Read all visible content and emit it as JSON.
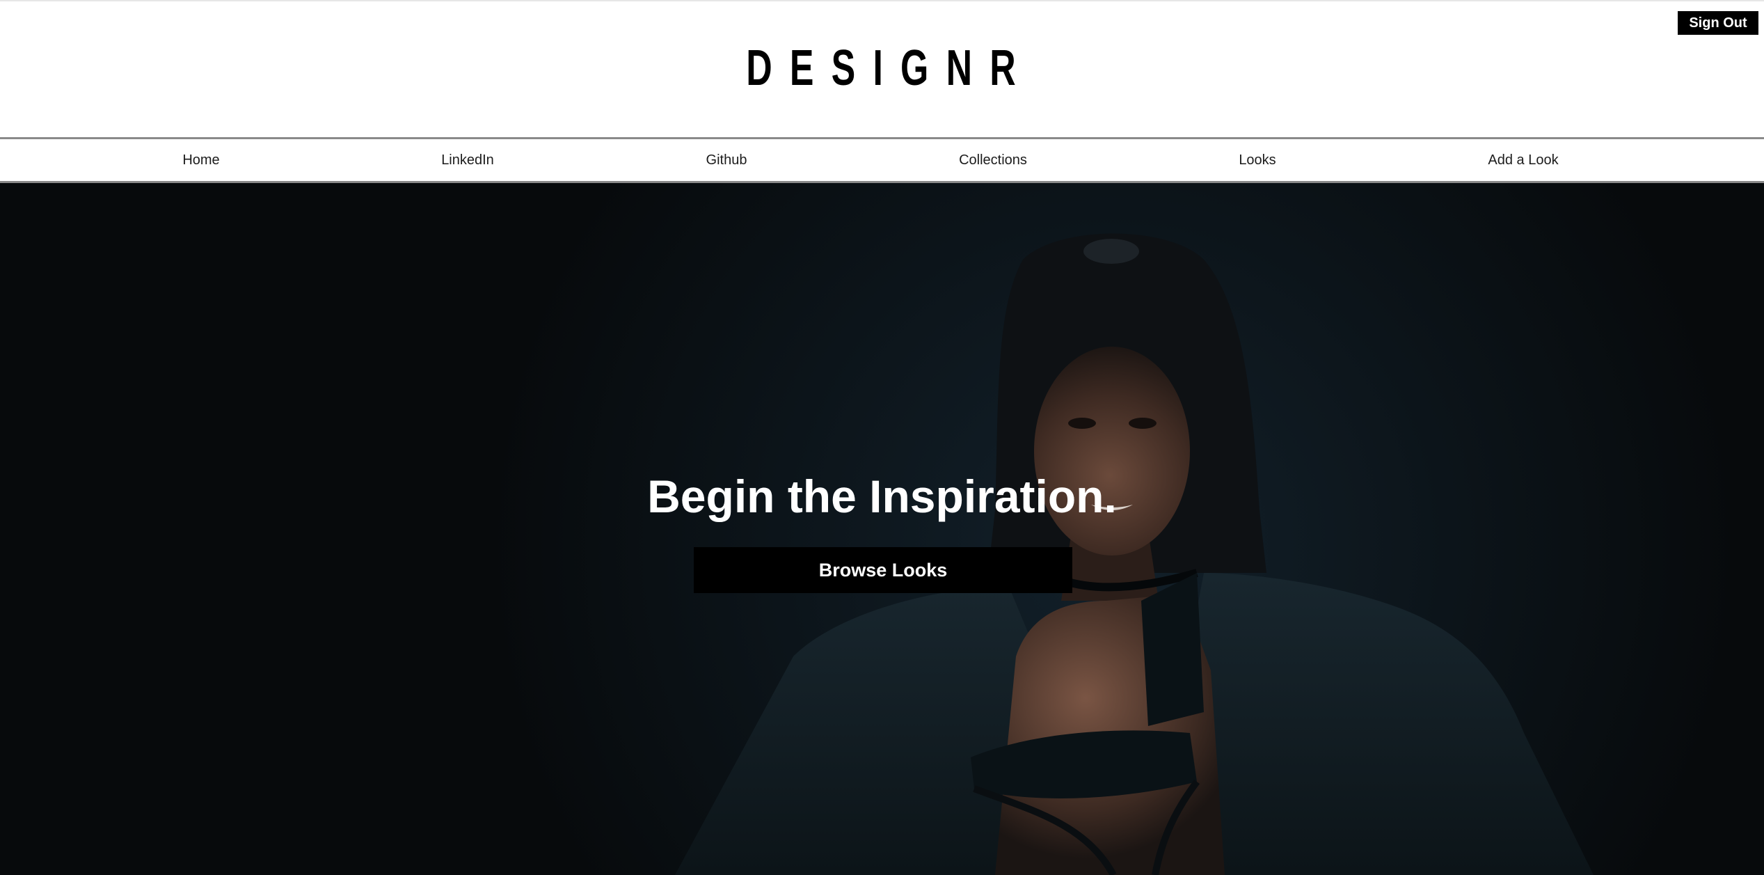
{
  "header": {
    "logo": "DESIGNR",
    "sign_out_label": "Sign Out"
  },
  "nav": {
    "items": [
      {
        "label": "Home"
      },
      {
        "label": "LinkedIn"
      },
      {
        "label": "Github"
      },
      {
        "label": "Collections"
      },
      {
        "label": "Looks"
      },
      {
        "label": "Add a Look"
      }
    ]
  },
  "hero": {
    "headline": "Begin the Inspiration.",
    "button_label": "Browse Looks",
    "background_color": "#070a0c"
  },
  "colors": {
    "brand": "#000000",
    "text_on_dark": "#ffffff",
    "nav_border": "#8a8a8a"
  }
}
